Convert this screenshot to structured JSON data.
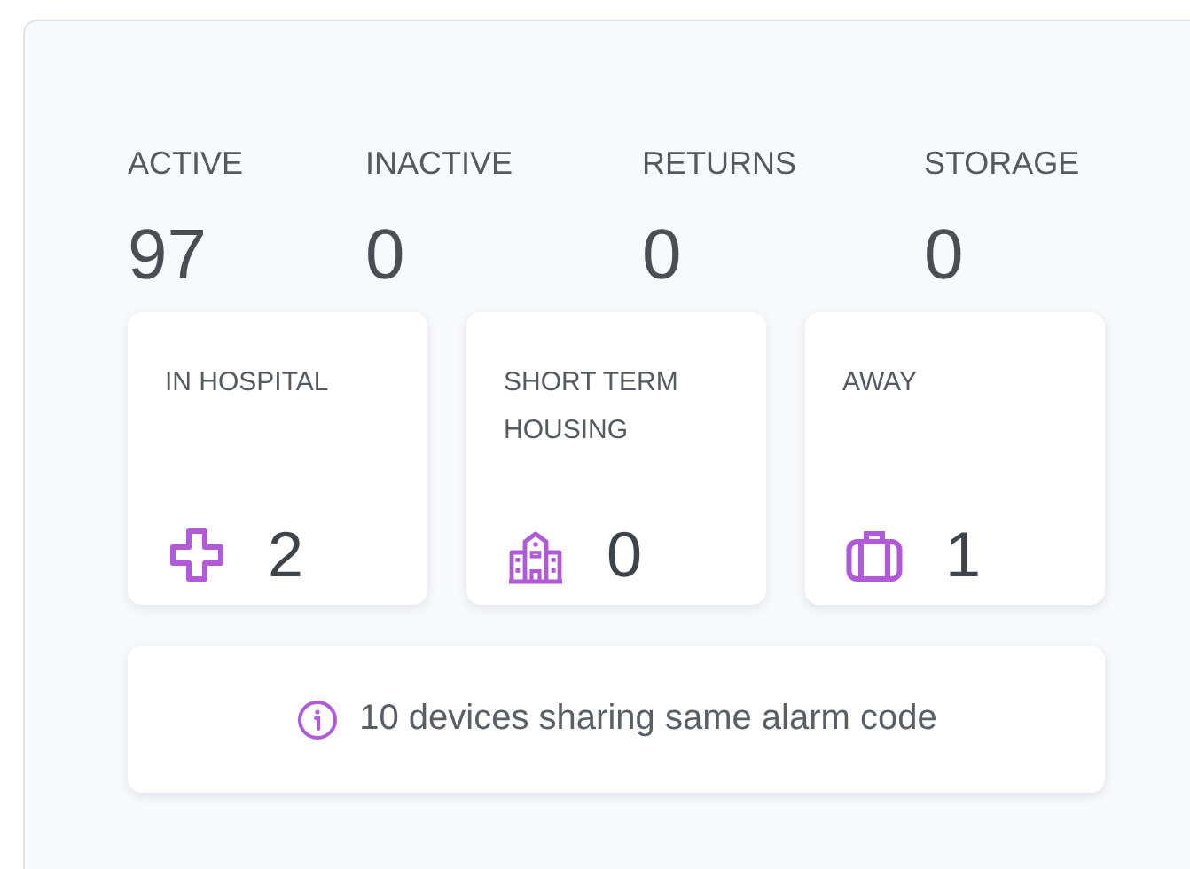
{
  "stats": [
    {
      "label": "ACTIVE",
      "value": "97"
    },
    {
      "label": "INACTIVE",
      "value": "0"
    },
    {
      "label": "RETURNS",
      "value": "0"
    },
    {
      "label": "STORAGE",
      "value": "0"
    }
  ],
  "cards": [
    {
      "label": "IN HOSPITAL",
      "value": "2"
    },
    {
      "label": "SHORT TERM HOUSING",
      "value": "0"
    },
    {
      "label": "AWAY",
      "value": "1"
    }
  ],
  "notice": {
    "text": "10 devices sharing same alarm code"
  }
}
